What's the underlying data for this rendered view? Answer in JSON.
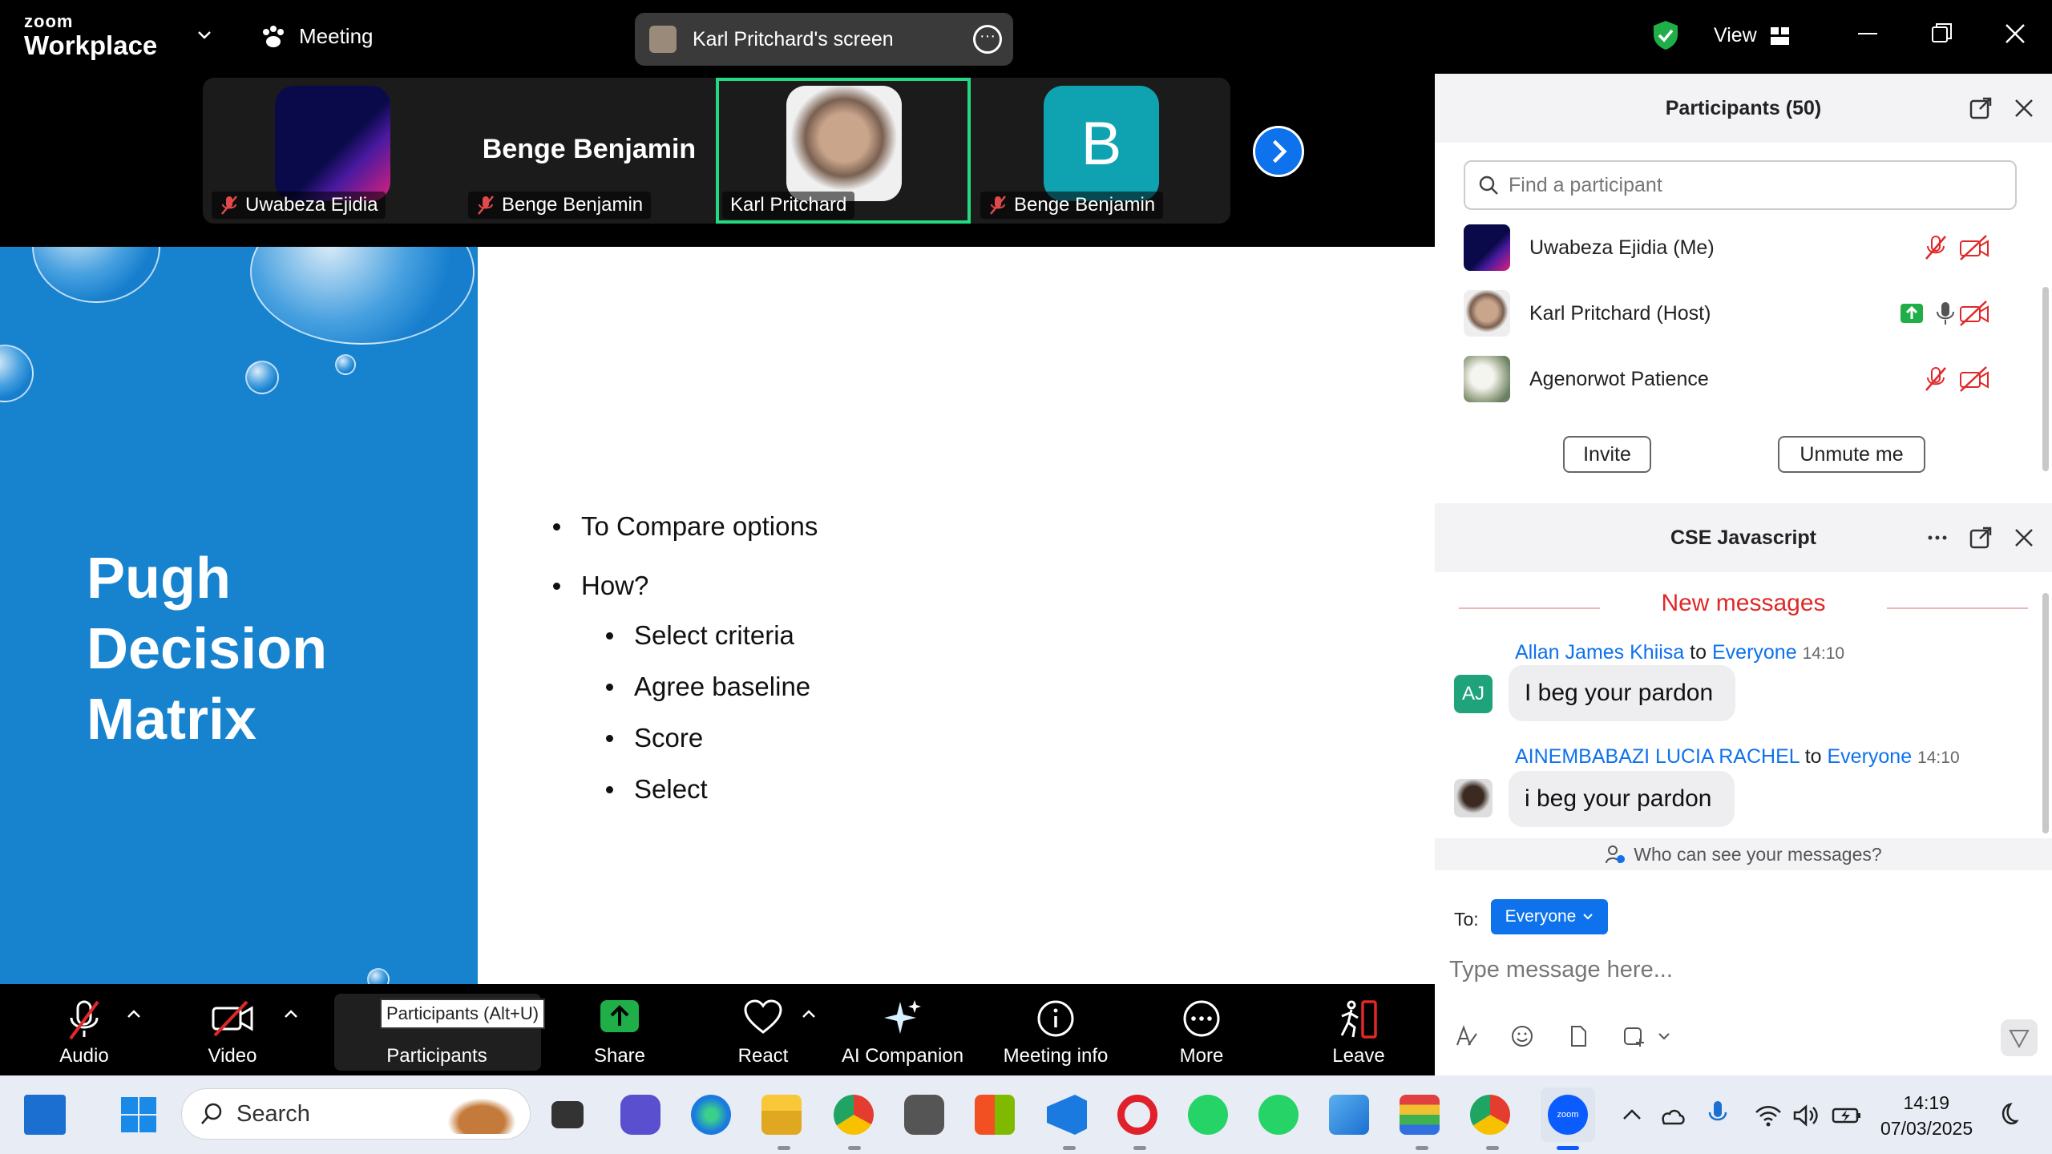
{
  "titlebar": {
    "logo_top": "zoom",
    "logo_bottom": "Workplace",
    "meeting_label": "Meeting",
    "screen_label": "Karl Pritchard's screen",
    "view_label": "View",
    "colors": {
      "shield": "#1fae48"
    }
  },
  "strip": {
    "tiles": [
      {
        "name": "Uwabeza Ejidia",
        "muted": true
      },
      {
        "name": "Benge Benjamin",
        "bigname": "Benge Benjamin",
        "muted": true
      },
      {
        "name": "Karl Pritchard",
        "muted": false,
        "active": true
      },
      {
        "name": "Benge Benjamin",
        "initial": "B",
        "muted": true
      }
    ]
  },
  "slide": {
    "title_lines": [
      "Pugh",
      "Decision",
      "Matrix"
    ],
    "bullets": [
      "To Compare options",
      "How?"
    ],
    "sub_bullets": [
      "Select criteria",
      "Agree baseline",
      "Score",
      "Select"
    ],
    "colors": {
      "left_panel": "#1783cf"
    }
  },
  "toolbar": {
    "audio": "Audio",
    "video": "Video",
    "participants": "Participants",
    "participants_tooltip": "Participants (Alt+U)",
    "share": "Share",
    "react": "React",
    "ai_companion": "AI Companion",
    "meeting_info": "Meeting info",
    "more": "More",
    "leave": "Leave"
  },
  "participants_panel": {
    "title": "Participants (50)",
    "search_placeholder": "Find a participant",
    "rows": [
      {
        "name": "Uwabeza Ejidia (Me)"
      },
      {
        "name": "Karl Pritchard (Host)"
      },
      {
        "name": "Agenorwot Patience"
      }
    ],
    "invite": "Invite",
    "unmute": "Unmute me"
  },
  "chat_panel": {
    "title": "CSE Javascript",
    "new_messages": "New messages",
    "messages": [
      {
        "sender": "Allan James Khiisa",
        "to_word": "to",
        "recipient": "Everyone",
        "time": "14:10",
        "text": "I beg your pardon",
        "initials": "AJ"
      },
      {
        "sender": "AINEMBABAZI LUCIA RACHEL",
        "to_word": "to",
        "recipient": "Everyone",
        "time": "14:10",
        "text": "i beg your pardon"
      }
    ],
    "who_can_see": "Who can see your messages?",
    "to_label": "To:",
    "to_value": "Everyone",
    "input_placeholder": "Type message here..."
  },
  "taskbar": {
    "search": "Search",
    "time": "14:19",
    "date": "07/03/2025"
  }
}
